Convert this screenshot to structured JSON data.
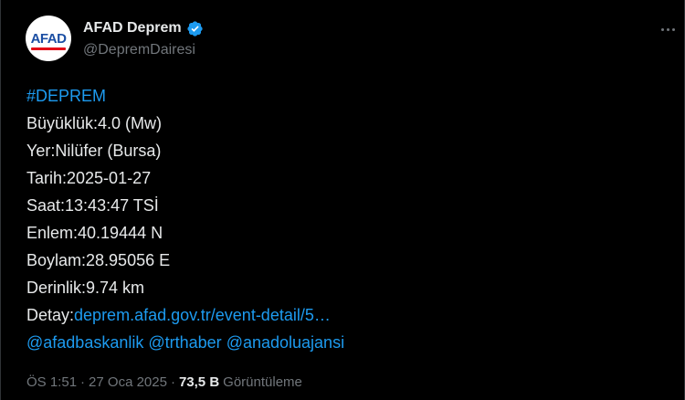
{
  "post": {
    "author": {
      "display_name": "AFAD Deprem",
      "handle": "@DepremDairesi",
      "avatar_text": "AFAD",
      "verified": true
    },
    "lines": {
      "hashtag": "#DEPREM",
      "magnitude": "Büyüklük:4.0 (Mw)",
      "location": "Yer:Nilüfer (Bursa)",
      "date": "Tarih:2025-01-27",
      "time": "Saat:13:43:47 TSİ",
      "latitude": "Enlem:40.19444 N",
      "longitude": "Boylam:28.95056 E",
      "depth": "Derinlik:9.74 km",
      "detail_label": "Detay:",
      "detail_link": "deprem.afad.gov.tr/event-detail/5…",
      "mention_1": "@afadbaskanlik",
      "mention_2": "@trthaber",
      "mention_3": "@anadoluajansi"
    },
    "meta": {
      "time": "ÖS 1:51",
      "separator": "·",
      "date": "27 Oca 2025",
      "views_count": "73,5 B",
      "views_label": "Görüntüleme"
    }
  },
  "colors": {
    "background": "#000000",
    "text": "#e7e9ea",
    "secondary": "#71767b",
    "link": "#1d9bf0",
    "verified": "#1d9bf0"
  },
  "icons": {
    "verified": "verified-badge-icon",
    "more": "more-horizontal-icon"
  }
}
